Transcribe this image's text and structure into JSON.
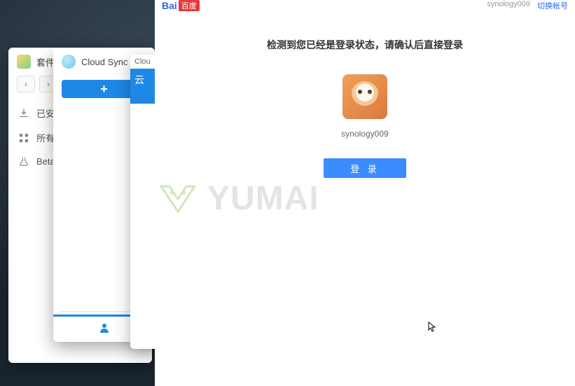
{
  "pkg_center": {
    "title": "套件中心",
    "items": [
      {
        "icon": "download",
        "label": "已安装"
      },
      {
        "icon": "grid",
        "label": "所有套件"
      },
      {
        "icon": "beta",
        "label": "Beta"
      }
    ]
  },
  "cloud_sync": {
    "title": "Cloud Sync",
    "add": "+"
  },
  "wizard": {
    "tab_partial": "Clou",
    "head_partial": "云"
  },
  "baidu": {
    "logo_blue": "Bai",
    "logo_red": "百度",
    "header_user": "synology009",
    "header_link": "切换帐号",
    "message": "检测到您已经是登录状态，请确认后直接登录",
    "username": "synology009",
    "login_btn": "登 录"
  },
  "watermark": "YUMAI"
}
